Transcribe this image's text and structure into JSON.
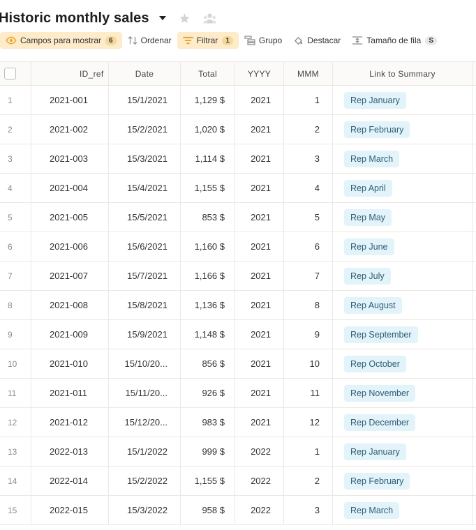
{
  "header": {
    "title": "Historic monthly sales"
  },
  "toolbar": {
    "fields": {
      "label": "Campos para mostrar",
      "count": "6"
    },
    "sort": {
      "label": "Ordenar"
    },
    "filter": {
      "label": "Filtrar",
      "count": "1"
    },
    "group": {
      "label": "Grupo"
    },
    "highlight": {
      "label": "Destacar"
    },
    "row_size": {
      "label": "Tamaño de fila",
      "value": "S"
    }
  },
  "colors": {
    "accent": "#e9a227",
    "active_bg": "#fdebc9",
    "chip_bg": "#e3f3fa",
    "chip_text": "#2e5d75"
  },
  "table": {
    "columns": [
      "ID_ref",
      "Date",
      "Total",
      "YYYY",
      "MMM",
      "Link to Summary"
    ],
    "rows": [
      {
        "num": "1",
        "id": "2021-001",
        "date": "15/1/2021",
        "total": "1,129 $",
        "yyyy": "2021",
        "mmm": "1",
        "link": "Rep January"
      },
      {
        "num": "2",
        "id": "2021-002",
        "date": "15/2/2021",
        "total": "1,020 $",
        "yyyy": "2021",
        "mmm": "2",
        "link": "Rep February"
      },
      {
        "num": "3",
        "id": "2021-003",
        "date": "15/3/2021",
        "total": "1,114 $",
        "yyyy": "2021",
        "mmm": "3",
        "link": "Rep March"
      },
      {
        "num": "4",
        "id": "2021-004",
        "date": "15/4/2021",
        "total": "1,155 $",
        "yyyy": "2021",
        "mmm": "4",
        "link": "Rep April"
      },
      {
        "num": "5",
        "id": "2021-005",
        "date": "15/5/2021",
        "total": "853 $",
        "yyyy": "2021",
        "mmm": "5",
        "link": "Rep May"
      },
      {
        "num": "6",
        "id": "2021-006",
        "date": "15/6/2021",
        "total": "1,160 $",
        "yyyy": "2021",
        "mmm": "6",
        "link": "Rep June"
      },
      {
        "num": "7",
        "id": "2021-007",
        "date": "15/7/2021",
        "total": "1,166 $",
        "yyyy": "2021",
        "mmm": "7",
        "link": "Rep July"
      },
      {
        "num": "8",
        "id": "2021-008",
        "date": "15/8/2021",
        "total": "1,136 $",
        "yyyy": "2021",
        "mmm": "8",
        "link": "Rep August"
      },
      {
        "num": "9",
        "id": "2021-009",
        "date": "15/9/2021",
        "total": "1,148 $",
        "yyyy": "2021",
        "mmm": "9",
        "link": "Rep September"
      },
      {
        "num": "10",
        "id": "2021-010",
        "date": "15/10/20...",
        "total": "856 $",
        "yyyy": "2021",
        "mmm": "10",
        "link": "Rep October"
      },
      {
        "num": "11",
        "id": "2021-011",
        "date": "15/11/20...",
        "total": "926 $",
        "yyyy": "2021",
        "mmm": "11",
        "link": "Rep November"
      },
      {
        "num": "12",
        "id": "2021-012",
        "date": "15/12/20...",
        "total": "983 $",
        "yyyy": "2021",
        "mmm": "12",
        "link": "Rep December"
      },
      {
        "num": "13",
        "id": "2022-013",
        "date": "15/1/2022",
        "total": "999 $",
        "yyyy": "2022",
        "mmm": "1",
        "link": "Rep January"
      },
      {
        "num": "14",
        "id": "2022-014",
        "date": "15/2/2022",
        "total": "1,155 $",
        "yyyy": "2022",
        "mmm": "2",
        "link": "Rep February"
      },
      {
        "num": "15",
        "id": "2022-015",
        "date": "15/3/2022",
        "total": "958 $",
        "yyyy": "2022",
        "mmm": "3",
        "link": "Rep March"
      }
    ]
  }
}
